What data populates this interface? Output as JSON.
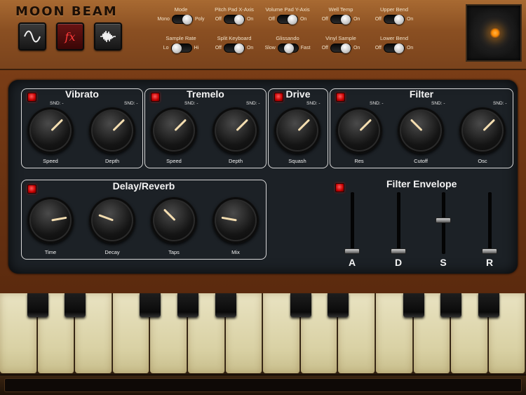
{
  "app": {
    "logo": "MOON BEAM"
  },
  "mode_buttons": [
    {
      "name": "waveform-button",
      "icon": "sine-wave-icon",
      "active": false
    },
    {
      "name": "fx-button",
      "label": "fx",
      "active": true
    },
    {
      "name": "sample-button",
      "icon": "sample-waveform-icon",
      "active": false
    }
  ],
  "switches": [
    {
      "id": "mode",
      "title": "Mode",
      "left": "Mono",
      "right": "Poly",
      "state": "right"
    },
    {
      "id": "pitch-pad-x",
      "title": "Pitch Pad X-Axis",
      "left": "Off",
      "right": "On",
      "state": "right"
    },
    {
      "id": "volume-pad-y",
      "title": "Volume Pad Y-Axis",
      "left": "Off",
      "right": "On",
      "state": "right"
    },
    {
      "id": "well-temp",
      "title": "Well Temp",
      "left": "Off",
      "right": "On",
      "state": "right"
    },
    {
      "id": "upper-bend",
      "title": "Upper Bend",
      "left": "Off",
      "right": "On",
      "state": "right"
    },
    {
      "id": "sample-rate",
      "title": "Sample Rate",
      "left": "Lo",
      "right": "Hi",
      "state": "left"
    },
    {
      "id": "split-keyboard",
      "title": "Split Keyboard",
      "left": "Off",
      "right": "On",
      "state": "right"
    },
    {
      "id": "glissando",
      "title": "Glissando",
      "left": "Slow",
      "right": "Fast",
      "state": "mid"
    },
    {
      "id": "vinyl-sample",
      "title": "Vinyl Sample",
      "left": "Off",
      "right": "On",
      "state": "right"
    },
    {
      "id": "lower-bend",
      "title": "Lower Bend",
      "left": "Off",
      "right": "On",
      "state": "right"
    }
  ],
  "sections": {
    "vibrato": {
      "title": "Vibrato",
      "snd": [
        "SND: -",
        "SND: -"
      ],
      "knobs": [
        {
          "label": "Speed",
          "angle": 225
        },
        {
          "label": "Depth",
          "angle": 225
        }
      ]
    },
    "tremelo": {
      "title": "Tremelo",
      "snd": [
        "SND: -",
        "SND: -"
      ],
      "knobs": [
        {
          "label": "Speed",
          "angle": 225
        },
        {
          "label": "Depth",
          "angle": 225
        }
      ]
    },
    "drive": {
      "title": "Drive",
      "snd": [
        "SND: -"
      ],
      "knobs": [
        {
          "label": "Squash",
          "angle": 225
        }
      ]
    },
    "filter": {
      "title": "Filter",
      "snd": [
        "SND: -",
        "SND: -",
        "SND: -"
      ],
      "knobs": [
        {
          "label": "Res",
          "angle": 225
        },
        {
          "label": "Cutoff",
          "angle": 135
        },
        {
          "label": "Osc",
          "angle": 225
        }
      ]
    },
    "delay_reverb": {
      "title": "Delay/Reverb",
      "knobs": [
        {
          "label": "Time",
          "angle": 260
        },
        {
          "label": "Decay",
          "angle": 110
        },
        {
          "label": "Taps",
          "angle": 135
        },
        {
          "label": "Mix",
          "angle": 100
        }
      ]
    }
  },
  "filter_envelope": {
    "title": "Filter Envelope",
    "sliders": [
      {
        "label": "A",
        "value": 0.0
      },
      {
        "label": "D",
        "value": 0.0
      },
      {
        "label": "S",
        "value": 0.55
      },
      {
        "label": "R",
        "value": 0.0
      }
    ]
  }
}
